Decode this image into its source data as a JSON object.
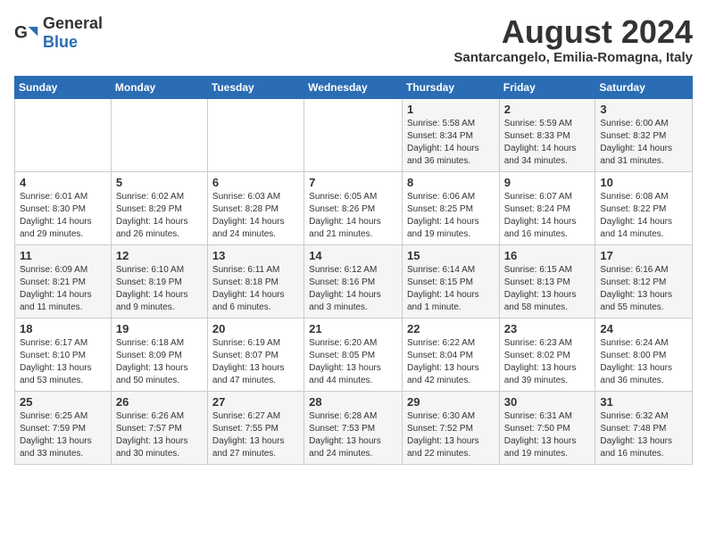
{
  "header": {
    "logo_general": "General",
    "logo_blue": "Blue",
    "month_title": "August 2024",
    "location": "Santarcangelo, Emilia-Romagna, Italy"
  },
  "days_of_week": [
    "Sunday",
    "Monday",
    "Tuesday",
    "Wednesday",
    "Thursday",
    "Friday",
    "Saturday"
  ],
  "weeks": [
    [
      {
        "day": "",
        "info": ""
      },
      {
        "day": "",
        "info": ""
      },
      {
        "day": "",
        "info": ""
      },
      {
        "day": "",
        "info": ""
      },
      {
        "day": "1",
        "info": "Sunrise: 5:58 AM\nSunset: 8:34 PM\nDaylight: 14 hours and 36 minutes."
      },
      {
        "day": "2",
        "info": "Sunrise: 5:59 AM\nSunset: 8:33 PM\nDaylight: 14 hours and 34 minutes."
      },
      {
        "day": "3",
        "info": "Sunrise: 6:00 AM\nSunset: 8:32 PM\nDaylight: 14 hours and 31 minutes."
      }
    ],
    [
      {
        "day": "4",
        "info": "Sunrise: 6:01 AM\nSunset: 8:30 PM\nDaylight: 14 hours and 29 minutes."
      },
      {
        "day": "5",
        "info": "Sunrise: 6:02 AM\nSunset: 8:29 PM\nDaylight: 14 hours and 26 minutes."
      },
      {
        "day": "6",
        "info": "Sunrise: 6:03 AM\nSunset: 8:28 PM\nDaylight: 14 hours and 24 minutes."
      },
      {
        "day": "7",
        "info": "Sunrise: 6:05 AM\nSunset: 8:26 PM\nDaylight: 14 hours and 21 minutes."
      },
      {
        "day": "8",
        "info": "Sunrise: 6:06 AM\nSunset: 8:25 PM\nDaylight: 14 hours and 19 minutes."
      },
      {
        "day": "9",
        "info": "Sunrise: 6:07 AM\nSunset: 8:24 PM\nDaylight: 14 hours and 16 minutes."
      },
      {
        "day": "10",
        "info": "Sunrise: 6:08 AM\nSunset: 8:22 PM\nDaylight: 14 hours and 14 minutes."
      }
    ],
    [
      {
        "day": "11",
        "info": "Sunrise: 6:09 AM\nSunset: 8:21 PM\nDaylight: 14 hours and 11 minutes."
      },
      {
        "day": "12",
        "info": "Sunrise: 6:10 AM\nSunset: 8:19 PM\nDaylight: 14 hours and 9 minutes."
      },
      {
        "day": "13",
        "info": "Sunrise: 6:11 AM\nSunset: 8:18 PM\nDaylight: 14 hours and 6 minutes."
      },
      {
        "day": "14",
        "info": "Sunrise: 6:12 AM\nSunset: 8:16 PM\nDaylight: 14 hours and 3 minutes."
      },
      {
        "day": "15",
        "info": "Sunrise: 6:14 AM\nSunset: 8:15 PM\nDaylight: 14 hours and 1 minute."
      },
      {
        "day": "16",
        "info": "Sunrise: 6:15 AM\nSunset: 8:13 PM\nDaylight: 13 hours and 58 minutes."
      },
      {
        "day": "17",
        "info": "Sunrise: 6:16 AM\nSunset: 8:12 PM\nDaylight: 13 hours and 55 minutes."
      }
    ],
    [
      {
        "day": "18",
        "info": "Sunrise: 6:17 AM\nSunset: 8:10 PM\nDaylight: 13 hours and 53 minutes."
      },
      {
        "day": "19",
        "info": "Sunrise: 6:18 AM\nSunset: 8:09 PM\nDaylight: 13 hours and 50 minutes."
      },
      {
        "day": "20",
        "info": "Sunrise: 6:19 AM\nSunset: 8:07 PM\nDaylight: 13 hours and 47 minutes."
      },
      {
        "day": "21",
        "info": "Sunrise: 6:20 AM\nSunset: 8:05 PM\nDaylight: 13 hours and 44 minutes."
      },
      {
        "day": "22",
        "info": "Sunrise: 6:22 AM\nSunset: 8:04 PM\nDaylight: 13 hours and 42 minutes."
      },
      {
        "day": "23",
        "info": "Sunrise: 6:23 AM\nSunset: 8:02 PM\nDaylight: 13 hours and 39 minutes."
      },
      {
        "day": "24",
        "info": "Sunrise: 6:24 AM\nSunset: 8:00 PM\nDaylight: 13 hours and 36 minutes."
      }
    ],
    [
      {
        "day": "25",
        "info": "Sunrise: 6:25 AM\nSunset: 7:59 PM\nDaylight: 13 hours and 33 minutes."
      },
      {
        "day": "26",
        "info": "Sunrise: 6:26 AM\nSunset: 7:57 PM\nDaylight: 13 hours and 30 minutes."
      },
      {
        "day": "27",
        "info": "Sunrise: 6:27 AM\nSunset: 7:55 PM\nDaylight: 13 hours and 27 minutes."
      },
      {
        "day": "28",
        "info": "Sunrise: 6:28 AM\nSunset: 7:53 PM\nDaylight: 13 hours and 24 minutes."
      },
      {
        "day": "29",
        "info": "Sunrise: 6:30 AM\nSunset: 7:52 PM\nDaylight: 13 hours and 22 minutes."
      },
      {
        "day": "30",
        "info": "Sunrise: 6:31 AM\nSunset: 7:50 PM\nDaylight: 13 hours and 19 minutes."
      },
      {
        "day": "31",
        "info": "Sunrise: 6:32 AM\nSunset: 7:48 PM\nDaylight: 13 hours and 16 minutes."
      }
    ]
  ]
}
